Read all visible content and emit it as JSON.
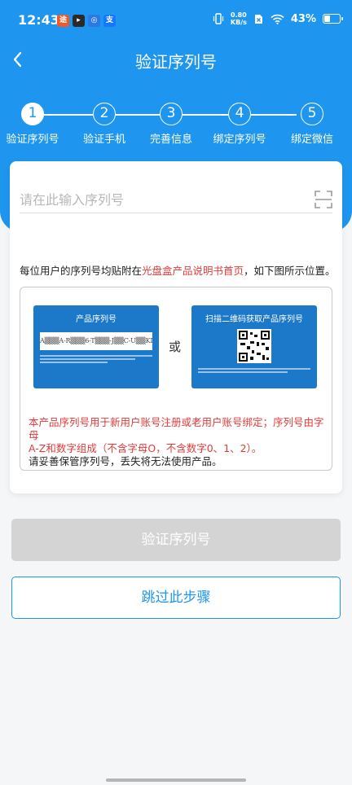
{
  "status_bar": {
    "time": "12:43",
    "net_speed_value": "0.80",
    "net_speed_unit": "KB/s",
    "battery_percent_text": "43%",
    "battery_level": 0.43
  },
  "header": {
    "title": "验证序列号"
  },
  "steps": [
    {
      "number": "1",
      "label": "验证序列号",
      "active": true
    },
    {
      "number": "2",
      "label": "验证手机",
      "active": false
    },
    {
      "number": "3",
      "label": "完善信息",
      "active": false
    },
    {
      "number": "4",
      "label": "绑定序列号",
      "active": false
    },
    {
      "number": "5",
      "label": "绑定微信",
      "active": false
    }
  ],
  "serial_input": {
    "placeholder": "请在此输入序列号",
    "value": ""
  },
  "hint": {
    "prefix": "每位用户的序列号均贴附在",
    "highlight": "光盘盒产品说明书首页",
    "suffix": "，如下图所示位置。"
  },
  "samples": {
    "left_title": "产品序列号",
    "left_serial": "A▒▒▒A-R▒▒▒6-T▒▒▒-J▒▒C-U▒▒KD",
    "right_title": "扫描二维码获取产品序列号",
    "or_text": "或"
  },
  "notice": {
    "red_line1": "本产品序列号用于新用户账号注册或老用户账号绑定；序列号由字母",
    "red_line2": "A-Z和数字组成（不含字母O，不含数字0、1、2）。",
    "dark_line": "请妥善保管序列号，丢失将无法使用产品。"
  },
  "buttons": {
    "verify_label": "验证序列号",
    "skip_label": "跳过此步骤"
  },
  "colors": {
    "primary": "#1e96f0",
    "warning_red": "#e23b3b",
    "disabled_button": "#d4d4d4"
  }
}
